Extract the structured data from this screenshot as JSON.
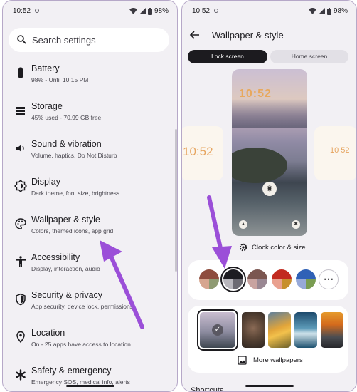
{
  "left": {
    "status": {
      "time": "10:52",
      "battery": "98%"
    },
    "search": {
      "placeholder": "Search settings"
    },
    "items": [
      {
        "title": "Battery",
        "subtitle": "98% - Until 10:15 PM",
        "icon": "battery-icon"
      },
      {
        "title": "Storage",
        "subtitle": "45% used - 70.99 GB free",
        "icon": "storage-icon"
      },
      {
        "title": "Sound & vibration",
        "subtitle": "Volume, haptics, Do Not Disturb",
        "icon": "speaker-icon"
      },
      {
        "title": "Display",
        "subtitle": "Dark theme, font size, brightness",
        "icon": "brightness-icon"
      },
      {
        "title": "Wallpaper & style",
        "subtitle": "Colors, themed icons, app grid",
        "icon": "palette-icon"
      },
      {
        "title": "Accessibility",
        "subtitle": "Display, interaction, audio",
        "icon": "accessibility-icon"
      },
      {
        "title": "Security & privacy",
        "subtitle": "App security, device lock, permissions",
        "icon": "shield-icon"
      },
      {
        "title": "Location",
        "subtitle": "On - 25 apps have access to location",
        "icon": "location-pin-icon"
      },
      {
        "title": "Safety & emergency",
        "subtitle": "Emergency SOS, medical info, alerts",
        "icon": "asterisk-icon"
      }
    ]
  },
  "right": {
    "status": {
      "time": "10:52",
      "battery": "98%"
    },
    "header": {
      "title": "Wallpaper & style"
    },
    "tabs": {
      "lock": "Lock screen",
      "home": "Home screen"
    },
    "preview": {
      "clock": "10:52",
      "left_clock": "10:52",
      "right_clock": "10 52"
    },
    "clock_button": "Clock color & size",
    "more_wallpapers": "More wallpapers",
    "shortcuts": "Shortcuts"
  },
  "colors": {
    "accent_arrow": "#9b4fd8",
    "tab_selected": "#1c1b1f",
    "clock_orange": "#e6a560"
  }
}
